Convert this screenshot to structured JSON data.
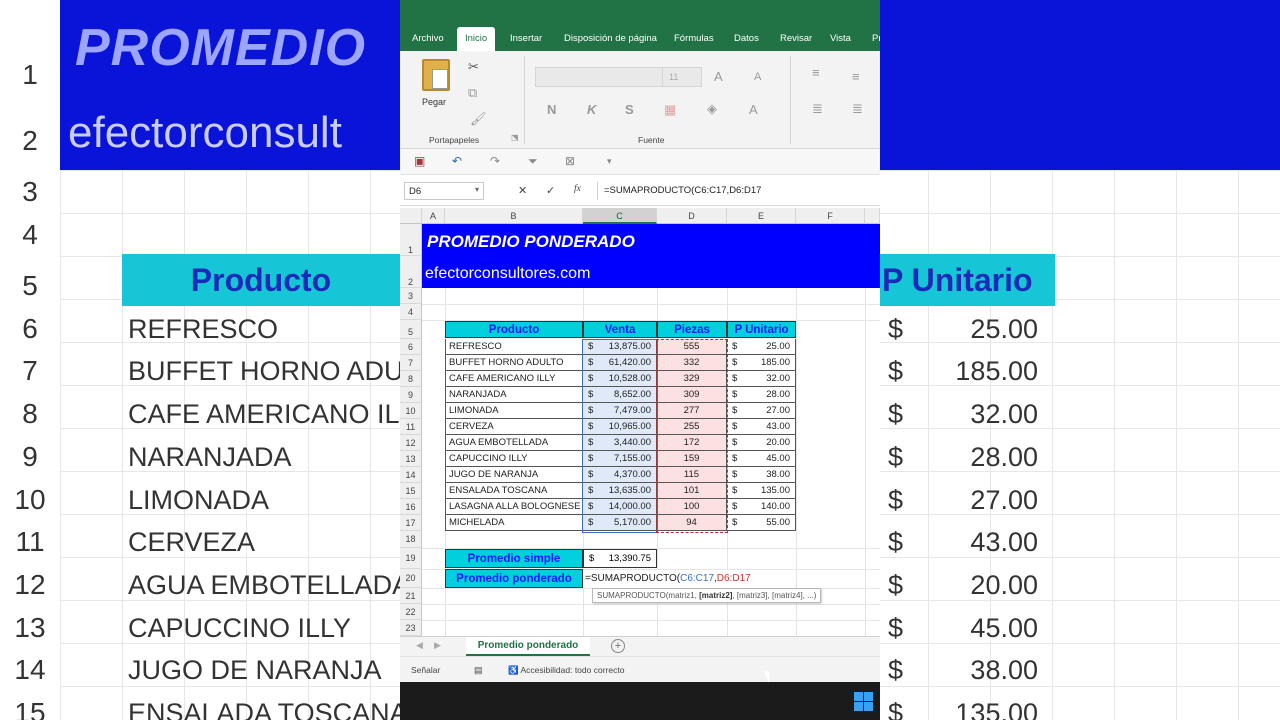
{
  "background": {
    "row_numbers": [
      "1",
      "2",
      "3",
      "4",
      "5",
      "6",
      "7",
      "8",
      "9",
      "10",
      "11",
      "12",
      "13",
      "14",
      "15"
    ],
    "title": "PROMEDIO",
    "subtitle": "efectorconsult",
    "header_left": "Producto",
    "header_right": "P Unitario",
    "items": [
      "REFRESCO",
      "BUFFET HORNO ADU",
      "CAFE AMERICANO IL",
      "NARANJADA",
      "LIMONADA",
      "CERVEZA",
      "AGUA EMBOTELLADA",
      "CAPUCCINO ILLY",
      "JUGO DE NARANJA",
      "ENSALADA TOSCANA"
    ],
    "prices": [
      "25.00",
      "185.00",
      "32.00",
      "28.00",
      "27.00",
      "43.00",
      "20.00",
      "45.00",
      "38.00",
      "135.00"
    ],
    "currency": "$",
    "colors": {
      "banner": "#0a14d9",
      "header": "#16c6d6"
    }
  },
  "ribbon": {
    "tabs": [
      "Archivo",
      "Inicio",
      "Insertar",
      "Disposición de página",
      "Fórmulas",
      "Datos",
      "Revisar",
      "Vista",
      "Pr"
    ],
    "active_tab": "Inicio",
    "paste_label": "Pegar",
    "group_clipboard": "Portapapeles",
    "group_font": "Fuente",
    "font_size": "11",
    "bold": "N",
    "italic": "K",
    "underline": "S",
    "grow": "A",
    "shrink": "A",
    "font_color": "A",
    "colors": {
      "tabbar": "#217346"
    }
  },
  "formula_bar": {
    "name_box": "D6",
    "cancel": "✕",
    "enter": "✓",
    "fx": "fx",
    "formula": "=SUMAPRODUCTO(C6:C17,D6:D17"
  },
  "sheet": {
    "columns": [
      "A",
      "B",
      "C",
      "D",
      "E",
      "F"
    ],
    "selected_column": "C",
    "row_numbers": [
      "1",
      "2",
      "3",
      "4",
      "5",
      "6",
      "7",
      "8",
      "9",
      "10",
      "11",
      "12",
      "13",
      "14",
      "15",
      "16",
      "17",
      "18",
      "19",
      "20",
      "21",
      "22",
      "23"
    ],
    "title": "PROMEDIO PONDERADO",
    "subtitle": "efectorconsultores.com",
    "headers": {
      "producto": "Producto",
      "venta": "Venta",
      "piezas": "Piezas",
      "pu": "P Unitario"
    },
    "currency": "$",
    "rows": [
      {
        "producto": "REFRESCO",
        "venta": "13,875.00",
        "piezas": "555",
        "pu": "25.00"
      },
      {
        "producto": "BUFFET HORNO ADULTO",
        "venta": "61,420.00",
        "piezas": "332",
        "pu": "185.00"
      },
      {
        "producto": "CAFE AMERICANO ILLY",
        "venta": "10,528.00",
        "piezas": "329",
        "pu": "32.00"
      },
      {
        "producto": "NARANJADA",
        "venta": "8,652.00",
        "piezas": "309",
        "pu": "28.00"
      },
      {
        "producto": "LIMONADA",
        "venta": "7,479.00",
        "piezas": "277",
        "pu": "27.00"
      },
      {
        "producto": "CERVEZA",
        "venta": "10,965.00",
        "piezas": "255",
        "pu": "43.00"
      },
      {
        "producto": "AGUA EMBOTELLADA",
        "venta": "3,440.00",
        "piezas": "172",
        "pu": "20.00"
      },
      {
        "producto": "CAPUCCINO ILLY",
        "venta": "7,155.00",
        "piezas": "159",
        "pu": "45.00"
      },
      {
        "producto": "JUGO DE NARANJA",
        "venta": "4,370.00",
        "piezas": "115",
        "pu": "38.00"
      },
      {
        "producto": "ENSALADA TOSCANA",
        "venta": "13,635.00",
        "piezas": "101",
        "pu": "135.00"
      },
      {
        "producto": "LASAGNA ALLA BOLOGNESE",
        "venta": "14,000.00",
        "piezas": "100",
        "pu": "140.00"
      },
      {
        "producto": "MICHELADA",
        "venta": "5,170.00",
        "piezas": "94",
        "pu": "55.00"
      }
    ],
    "promedio_simple_label": "Promedio simple",
    "promedio_simple_value": "13,390.75",
    "promedio_ponderado_label": "Promedio ponderado",
    "editing": {
      "prefix": "=SUMAPRODUCTO(",
      "range1": "C6:C17",
      "comma": ",",
      "range2": "D6:D17"
    },
    "tooltip": {
      "fn": "SUMAPRODUCTO(matriz1, ",
      "bold": "[matriz2]",
      "rest": ", [matriz3], [matriz4], ...)"
    },
    "colors": {
      "banner": "#0000ff",
      "header": "#00cfdd",
      "header_text": "#1a1aff"
    }
  },
  "sheet_tabs": {
    "active": "Promedio ponderado",
    "add": "+"
  },
  "status": {
    "mode": "Señalar",
    "accessibility": "Accesibilidad: todo correcto"
  }
}
